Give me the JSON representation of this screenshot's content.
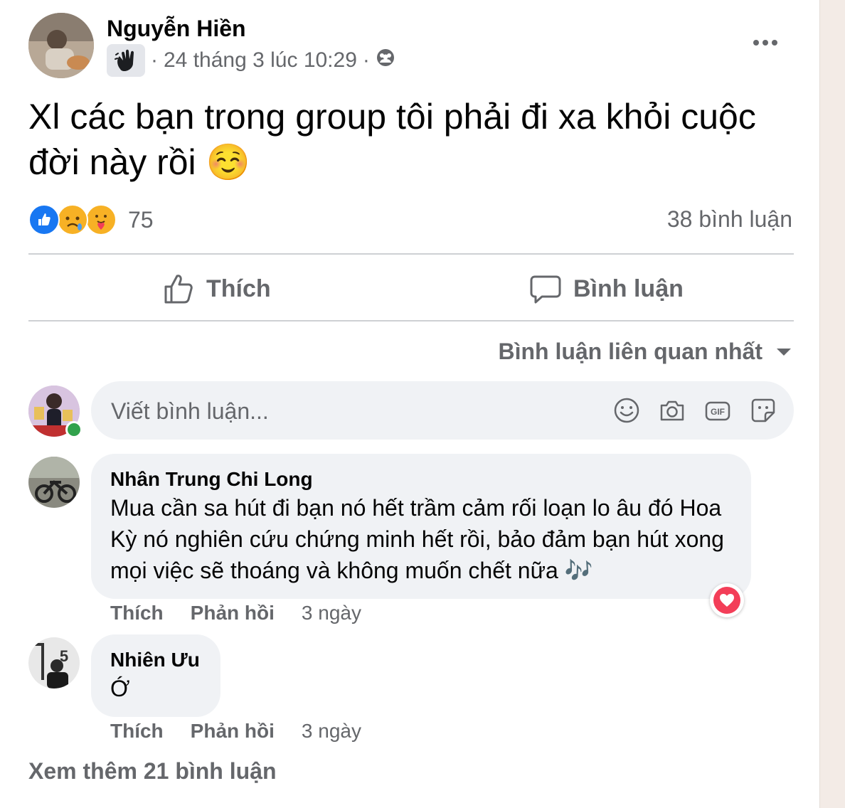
{
  "post": {
    "author": "Nguyễn Hiền",
    "timestamp": "24 tháng 3 lúc 10:29",
    "separator": "·",
    "audience_icon": "group-icon",
    "badge_icon": "waving-hand-icon",
    "text": "Xl các bạn trong group tôi phải đi xa khỏi cuộc đời này rồi",
    "emoji": "☺️",
    "reactions": {
      "icons": [
        "like-icon",
        "sad-icon",
        "care-icon"
      ],
      "count": "75"
    },
    "comment_count": "38 bình luận"
  },
  "actions": {
    "like": "Thích",
    "comment": "Bình luận"
  },
  "sort_label": "Bình luận liên quan nhất",
  "composer": {
    "placeholder": "Viết bình luận...",
    "icons": [
      "emoji-icon",
      "camera-icon",
      "gif-icon",
      "sticker-icon"
    ]
  },
  "comments": [
    {
      "name": "Nhân Trung Chi Long",
      "text": "Mua cần sa hút đi bạn nó hết trầm cảm rối loạn lo âu đó Hoa Kỳ nó nghiên cứu chứng minh hết rồi, bảo đảm bạn hút xong mọi việc sẽ thoáng và không muốn chết nữa 🎶",
      "like": "Thích",
      "reply": "Phản hồi",
      "time": "3 ngày",
      "reaction": "heart-icon"
    },
    {
      "name": "Nhiên Ưu",
      "text": "Ớ",
      "like": "Thích",
      "reply": "Phản hồi",
      "time": "3 ngày"
    }
  ],
  "view_more": "Xem thêm 21 bình luận",
  "colors": {
    "secondary_text": "#65676b",
    "bubble": "#f0f2f5",
    "like_blue": "#1877f2",
    "heart_red": "#f33e58",
    "online_green": "#31a24c"
  }
}
